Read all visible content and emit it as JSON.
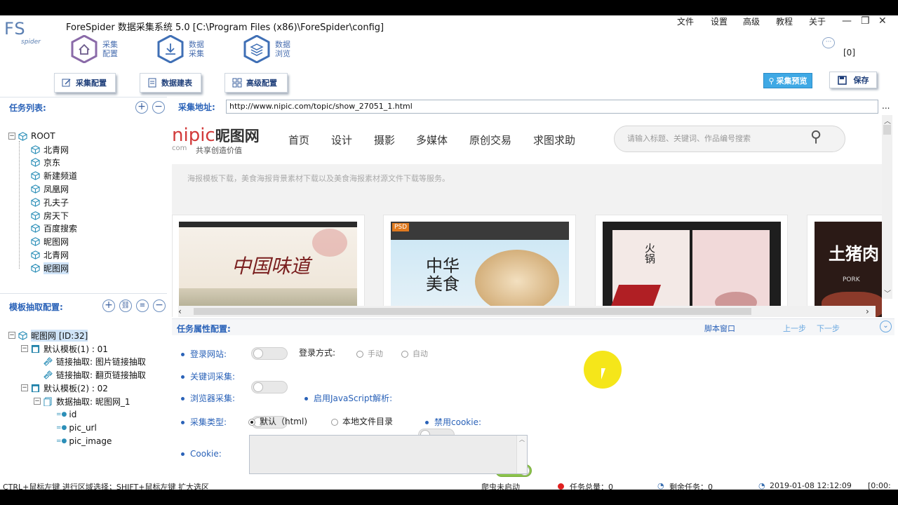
{
  "app": {
    "logo_text": "FS",
    "logo_sub": "spider",
    "title": "ForeSpider 数据采集系统  5.0  [C:\\Program Files (x86)\\ForeSpider\\config]",
    "menu": [
      "文件",
      "设置",
      "高级",
      "教程",
      "关于"
    ],
    "window_buttons": [
      "—",
      "❐",
      "✕"
    ],
    "message_count": "[0]"
  },
  "hexnav": [
    {
      "line1": "采集",
      "line2": "配置",
      "icon": "home-icon"
    },
    {
      "line1": "数据",
      "line2": "采集",
      "icon": "download-icon"
    },
    {
      "line1": "数据",
      "line2": "浏览",
      "icon": "layers-icon"
    }
  ],
  "subtabs": [
    {
      "label": "采集配置",
      "icon": "edit-icon"
    },
    {
      "label": "数据建表",
      "icon": "document-icon"
    },
    {
      "label": "高级配置",
      "icon": "grid-icon"
    }
  ],
  "toolbar": {
    "preview_label": "采集预览",
    "save_label": "保存"
  },
  "tasks": {
    "title": "任务列表:",
    "root": "ROOT",
    "items": [
      "北青网",
      "京东",
      "新建频道",
      "凤凰网",
      "孔夫子",
      "房天下",
      "百度搜索",
      "昵图网",
      "北青网",
      "昵图网"
    ],
    "selected_index": 9
  },
  "template": {
    "title": "模板抽取配置:",
    "root": "昵图网 [ID:32]",
    "nodes": [
      {
        "label": "默认模板(1) : 01",
        "level": 1
      },
      {
        "label": "链接抽取: 图片链接抽取",
        "level": 2
      },
      {
        "label": "链接抽取: 翻页链接抽取",
        "level": 2
      },
      {
        "label": "默认模板(2) : 02",
        "level": 1
      },
      {
        "label": "数据抽取: 昵图网_1",
        "level": 2
      },
      {
        "label": "id",
        "level": 3
      },
      {
        "label": "pic_url",
        "level": 3
      },
      {
        "label": "pic_image",
        "level": 3
      }
    ]
  },
  "browser": {
    "url_label": "采集地址:",
    "url": "http://www.nipic.com/topic/show_27051_1.html",
    "more": "...",
    "site_logo": "nipic",
    "site_logo_cn": "昵图网",
    "site_logo_com": "com",
    "site_slogan": "共享创造价值",
    "nav": [
      "首页",
      "设计",
      "摄影",
      "多媒体",
      "原创交易",
      "求图求助"
    ],
    "search_placeholder": "请输入标题、关键词、作品编号搜索",
    "desc_text": "海报模板下载，美食海报背景素材下载以及美食海报素材源文件下载等服务。",
    "cards": [
      {
        "caption": "中国味道"
      },
      {
        "caption": "中华美食",
        "badge": "PSD"
      },
      {
        "caption": "火锅"
      },
      {
        "caption": "土猪肉",
        "sub": "PORK"
      }
    ]
  },
  "props": {
    "title": "任务属性配置:",
    "script_window": "脚本窗口",
    "prev": "上一步",
    "next": "下一步",
    "login_site": "登录网站:",
    "login_mode_label": "登录方式:",
    "login_mode_manual": "手动",
    "login_mode_auto": "自动",
    "keyword": "关键词采集:",
    "browser_collect": "浏览器采集:",
    "js_parse": "启用JavaScript解析:",
    "collect_type": "采集类型:",
    "type_default": "默认（html)",
    "type_local": "本地文件目录",
    "disable_cookie": "禁用cookie:",
    "cookie_label": "Cookie:",
    "cookie_value": ""
  },
  "status": {
    "hint": "CTRL+鼠标左键 进行区域选择；SHIFT+鼠标左键 扩大选区",
    "spider": "爬虫未启动",
    "total": "任务总量：0",
    "remaining": "剩余任务：0",
    "time": "2019-01-08 12:12:09",
    "extra": "[0:00:"
  }
}
